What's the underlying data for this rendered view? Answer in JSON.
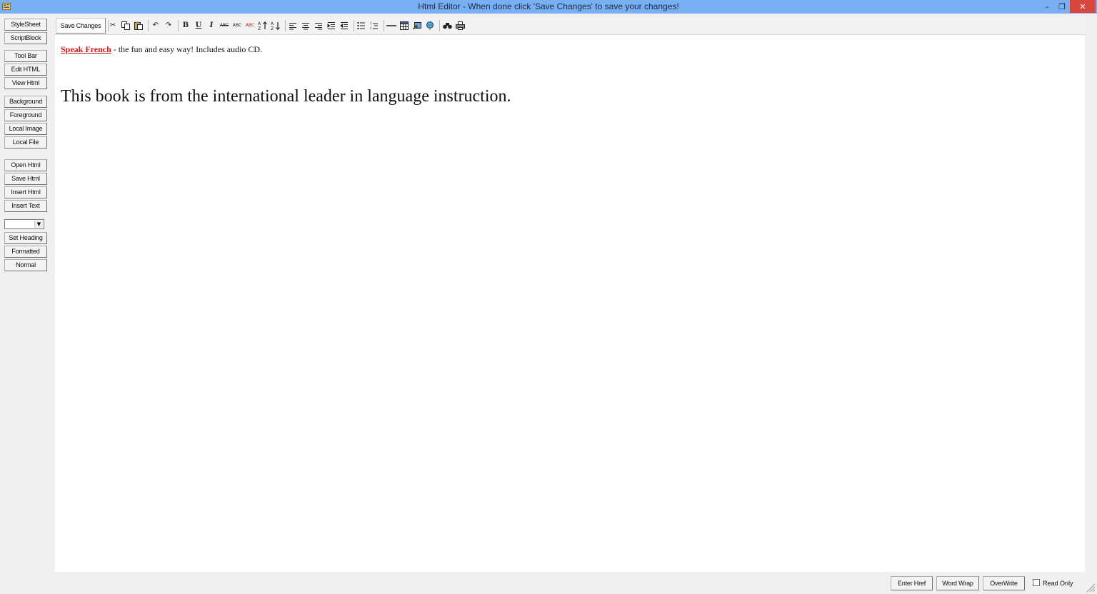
{
  "window": {
    "title": "Html Editor - When done click 'Save Changes' to save your changes!",
    "controls": {
      "minimize": "–",
      "maximize": "❐",
      "close": "✕"
    }
  },
  "sidebar": {
    "buttons": [
      "StyleSheet",
      "ScriptBlock",
      "Tool Bar",
      "Edit HTML",
      "View Html",
      "Background",
      "Foreground",
      "Local Image",
      "Local File",
      "Open Html",
      "Save Html",
      "Insert Html",
      "Insert Text",
      "Set Heading",
      "Formatted",
      "Normal"
    ],
    "heading_select_value": ""
  },
  "toolbar": {
    "save_label": "Save Changes",
    "icons": [
      "cut-icon",
      "copy-icon",
      "paste-icon",
      "undo-icon",
      "redo-icon",
      "bold-icon",
      "underline-icon",
      "italic-icon",
      "strikethrough-icon",
      "superscript-icon",
      "subscript-icon",
      "sort-ascending-icon",
      "sort-descending-icon",
      "align-left-icon",
      "align-center-icon",
      "align-right-icon",
      "indent-icon",
      "outdent-icon",
      "bulleted-list-icon",
      "numbered-list-icon",
      "horizontal-rule-icon",
      "table-icon",
      "insert-image-icon",
      "insert-link-icon",
      "find-icon",
      "print-icon"
    ]
  },
  "editor": {
    "link_text": "Speak French",
    "line1_rest": " - the fun and easy way! Includes audio CD.",
    "heading": "This book is from the international leader in language instruction.",
    "link_color": "#c81818"
  },
  "bottom": {
    "enter_href": "Enter Href",
    "word_wrap": "Word Wrap",
    "overwrite": "OverWrite",
    "read_only_label": "Read Only",
    "read_only_checked": false
  },
  "colors": {
    "titlebar": "#79b0f3",
    "close_button": "#d9473c",
    "window_background": "#f0f0f0",
    "editor_background": "#ffffff"
  }
}
